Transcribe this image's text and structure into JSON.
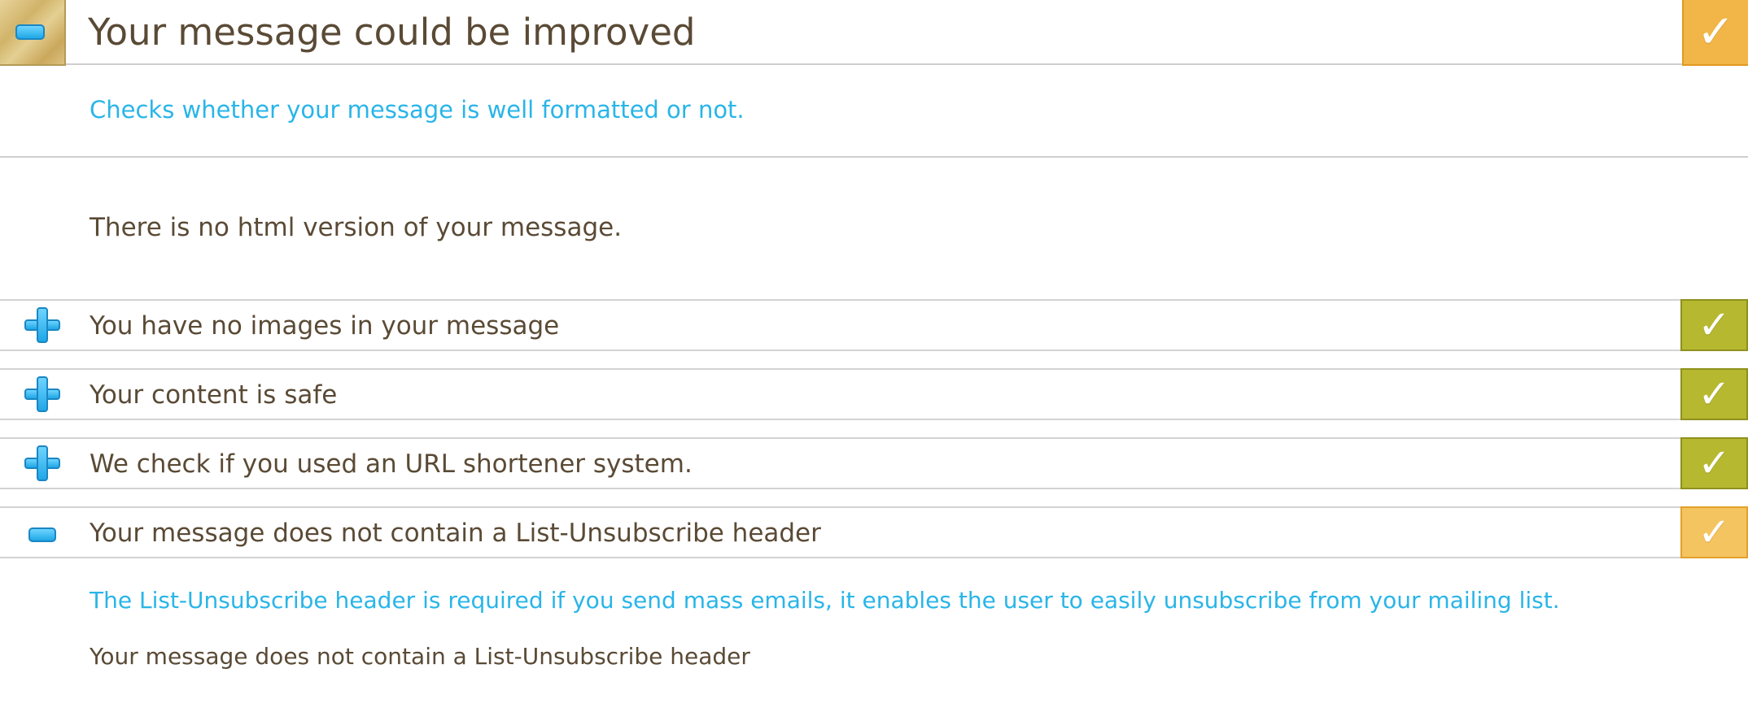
{
  "section": {
    "title": "Your message could be improved",
    "description": "Checks whether your message is well formatted or not.",
    "detail": "There is no html version of your message.",
    "status": "warning"
  },
  "rows": [
    {
      "label": "You have no images in your message",
      "toggle": "plus-icon",
      "status": "ok"
    },
    {
      "label": "Your content is safe",
      "toggle": "plus-icon",
      "status": "ok"
    },
    {
      "label": "We check if you used an URL shortener system.",
      "toggle": "plus-icon",
      "status": "ok"
    },
    {
      "label": "Your message does not contain a List-Unsubscribe header",
      "toggle": "minus-icon",
      "status": "warning"
    }
  ],
  "expanded": {
    "description": "The List-Unsubscribe header is required if you send mass emails, it enables the user to easily unsubscribe from your mailing list.",
    "detail": "Your message does not contain a List-Unsubscribe header"
  },
  "icons": {
    "check": "✓"
  },
  "colors": {
    "ok": "#b6b830",
    "warning": "#f2b548",
    "accent_text": "#29b5e8",
    "body_text": "#5a4a35"
  }
}
